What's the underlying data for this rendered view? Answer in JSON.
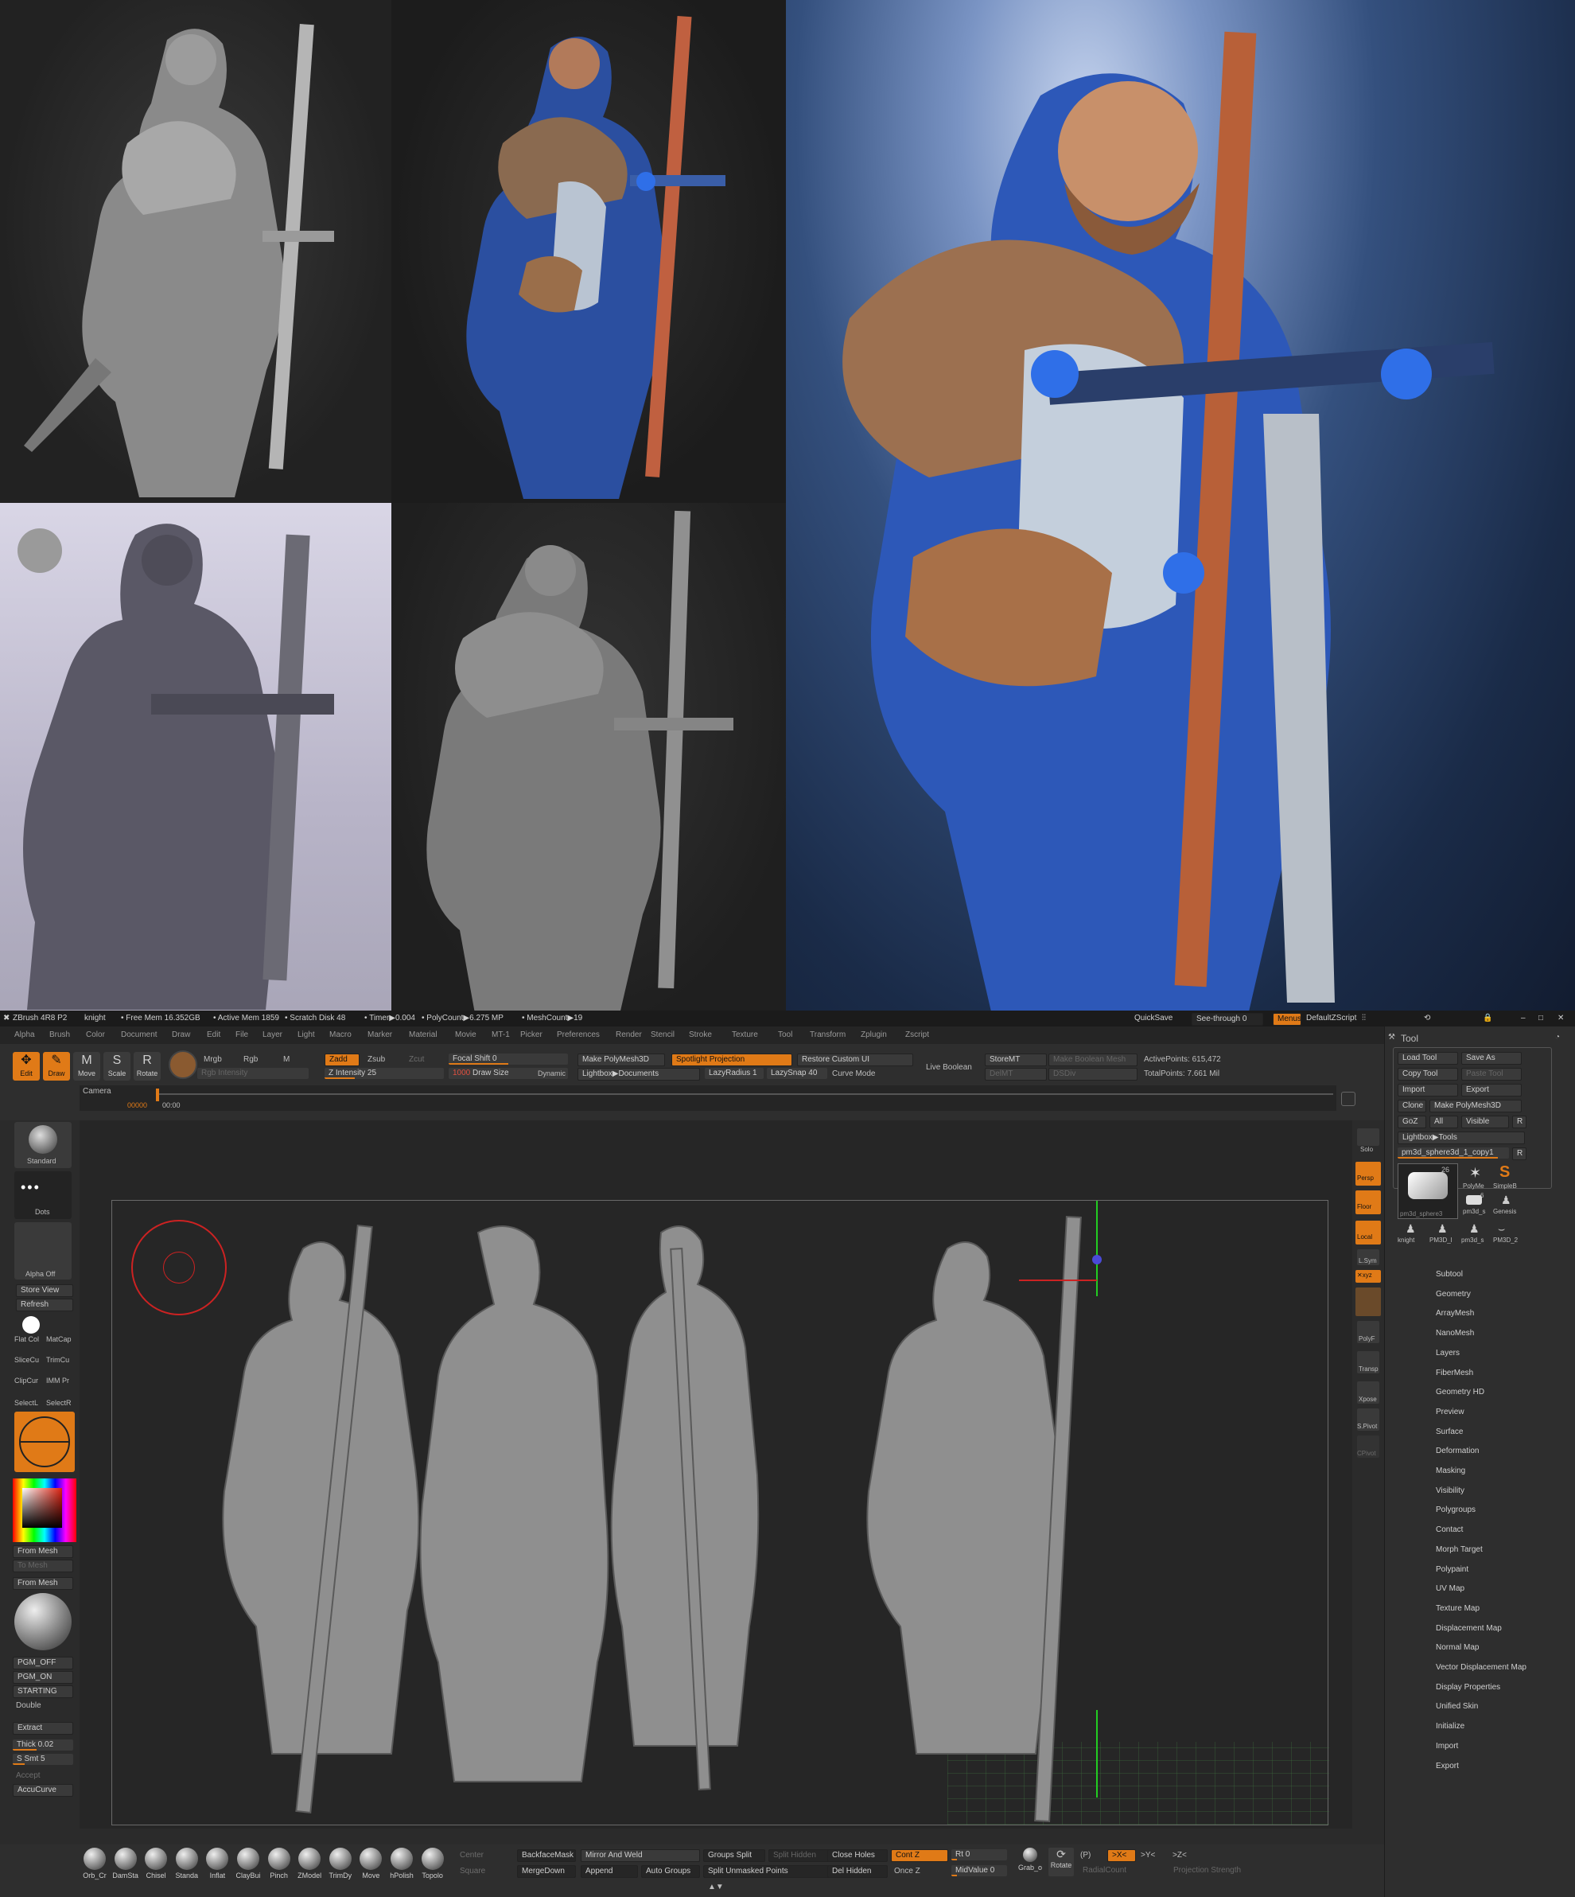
{
  "titlebar": {
    "app": "ZBrush 4R8 P2",
    "doc": "knight",
    "free_mem": "• Free Mem 16.352GB",
    "active_mem": "• Active Mem 1859",
    "scratch": "• Scratch Disk 48",
    "timer": "• Timer▶0.004",
    "polycount": "• PolyCount▶6.275 MP",
    "meshcount": "• MeshCount▶19",
    "quicksave": "QuickSave",
    "see_through": "See-through  0",
    "menus": "Menus",
    "default_zscript": "DefaultZScript"
  },
  "menus": [
    "Alpha",
    "Brush",
    "Color",
    "Document",
    "Draw",
    "Edit",
    "File",
    "Layer",
    "Light",
    "Macro",
    "Marker",
    "Material",
    "Movie",
    "MT-1",
    "Picker",
    "Preferences",
    "Render",
    "Stencil",
    "Stroke",
    "Texture",
    "Tool",
    "Transform",
    "Zplugin",
    "Zscript"
  ],
  "shelf": {
    "edit": "Edit",
    "draw": "Draw",
    "move": "Move",
    "scale": "Scale",
    "rotate": "Rotate",
    "mrgb": "Mrgb",
    "rgb": "Rgb",
    "m": "M",
    "rgb_intensity": "Rgb Intensity",
    "zadd": "Zadd",
    "zsub": "Zsub",
    "zcut": "Zcut",
    "z_intensity": "Z Intensity 25",
    "focal_shift": "Focal Shift 0",
    "draw_size_val": "1000",
    "draw_size": "Draw Size",
    "dynamic": "Dynamic",
    "make_polymesh": "Make PolyMesh3D",
    "spotlight": "Spotlight Projection",
    "restore_ui": "Restore Custom UI",
    "lightbox_docs": "Lightbox▶Documents",
    "lazyradius": "LazyRadius 1",
    "lazysnap": "LazySnap 40",
    "curve_mode": "Curve Mode",
    "live_boolean": "Live Boolean",
    "storemt": "StoreMT",
    "delmt": "DelMT",
    "make_boolean": "Make Boolean Mesh",
    "dsdiv": "DSDiv",
    "active_points": "ActivePoints: 615,472",
    "total_points": "TotalPoints: 7.661 Mil",
    "camera": "Camera",
    "timeline_a": "00000",
    "timeline_b": "00:00"
  },
  "left_tray": {
    "standard": "Standard",
    "dots": "Dots",
    "alpha_off": "Alpha Off",
    "store_view": "Store View",
    "refresh": "Refresh",
    "flat_col": "Flat Col",
    "matcap": "MatCap",
    "slicecu": "SliceCu",
    "trimcu": "TrimCu",
    "clipcur": "ClipCur",
    "imm_pr": "IMM Pr",
    "selectl": "SelectL",
    "selectr": "SelectR",
    "from_mesh": "From Mesh",
    "to_mesh": "To Mesh",
    "from_mesh2": "From Mesh",
    "pgm_off": "PGM_OFF",
    "pgm_on": "PGM_ON",
    "starting": "STARTING",
    "double": "Double",
    "extract": "Extract",
    "thick": "Thick 0.02",
    "s_smt": "S Smt 5",
    "accept": "Accept",
    "accucurve": "AccuCurve"
  },
  "right_tray": {
    "solo": "Solo",
    "persp": "Persp",
    "floor": "Floor",
    "local": "Local",
    "l_sym": "L.Sym",
    "xyz": "✕xyz",
    "polyf": "PolyF",
    "transp": "Transp",
    "xpose": "Xpose",
    "s_pivot": "S.Pivot",
    "c_pivot": "CPivot"
  },
  "tool_panel": {
    "title": "Tool",
    "load_tool": "Load Tool",
    "save_as": "Save As",
    "copy_tool": "Copy Tool",
    "paste_tool": "Paste Tool",
    "import": "Import",
    "export": "Export",
    "clone": "Clone",
    "make_polymesh": "Make PolyMesh3D",
    "goz": "GoZ",
    "all": "All",
    "visible": "Visible",
    "r": "R",
    "lightbox_tools": "Lightbox▶Tools",
    "current_tool": "pm3d_sphere3d_1_copy1",
    "r2": "R",
    "thumb_count1": "26",
    "thumb_count2": "6",
    "thumb_labels": [
      "pm3d_sphere3",
      "PolyMe",
      "SimpleB",
      "pm3d_s",
      "Genesis",
      "knight",
      "PM3D_l",
      "pm3d_s",
      "PM3D_2"
    ],
    "items": [
      "Subtool",
      "Geometry",
      "ArrayMesh",
      "NanoMesh",
      "Layers",
      "FiberMesh",
      "Geometry HD",
      "Preview",
      "Surface",
      "Deformation",
      "Masking",
      "Visibility",
      "Polygroups",
      "Contact",
      "Morph Target",
      "Polypaint",
      "UV Map",
      "Texture Map",
      "Displacement Map",
      "Normal Map",
      "Vector Displacement Map",
      "Display Properties",
      "Unified Skin",
      "Initialize",
      "Import",
      "Export"
    ]
  },
  "bottom_shelf": {
    "brushes": [
      "Orb_Cr",
      "DamSta",
      "Chisel",
      "Standa",
      "Inflat",
      "ClayBui",
      "Pinch",
      "ZModel",
      "TrimDy",
      "Move",
      "hPolish",
      "Topolo"
    ],
    "center": "Center",
    "square": "Square",
    "backfacemask": "BackfaceMask",
    "mergedown": "MergeDown",
    "mirror_weld": "Mirror And Weld",
    "append": "Append",
    "auto_groups": "Auto Groups",
    "groups_split": "Groups Split",
    "split_hidden": "Split Hidden",
    "split_unmasked": "Split Unmasked Points",
    "close_holes": "Close Holes",
    "del_hidden": "Del Hidden",
    "cont_z": "Cont Z",
    "once_z": "Once Z",
    "rt": "Rt 0",
    "midvalue": "MidValue 0",
    "grab": "Grab_o",
    "rotate": "Rotate",
    "p": "(P)",
    "radialcount": "RadialCount",
    "xc": ">X<",
    "yc": ">Y<",
    "zc": ">Z<",
    "projection_strength": "Projection Strength"
  }
}
